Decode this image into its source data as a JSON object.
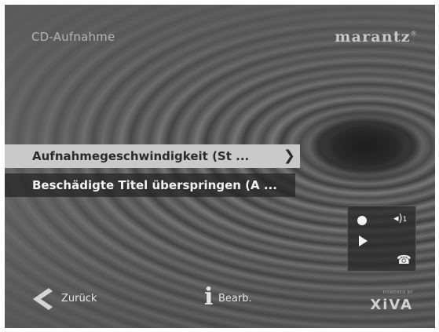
{
  "header": {
    "title": "CD-Aufnahme",
    "brand": "marantz",
    "brand_mark": "®"
  },
  "menu": {
    "items": [
      {
        "label": "Aufnahmegeschwindigkeit (St ...",
        "selected": true
      },
      {
        "label": "Beschädigte Titel überspringen (A ...",
        "selected": false
      }
    ]
  },
  "status_panel": {
    "volume_value": "1"
  },
  "footer": {
    "back_label": "Zurück",
    "edit_label": "Bearb.",
    "xiva_small": "POWERED BY",
    "xiva": "XiVA"
  },
  "colors": {
    "highlight": "#c9c9c9",
    "text_light": "#f2f2f2",
    "text_dark": "#2a2a2a"
  }
}
